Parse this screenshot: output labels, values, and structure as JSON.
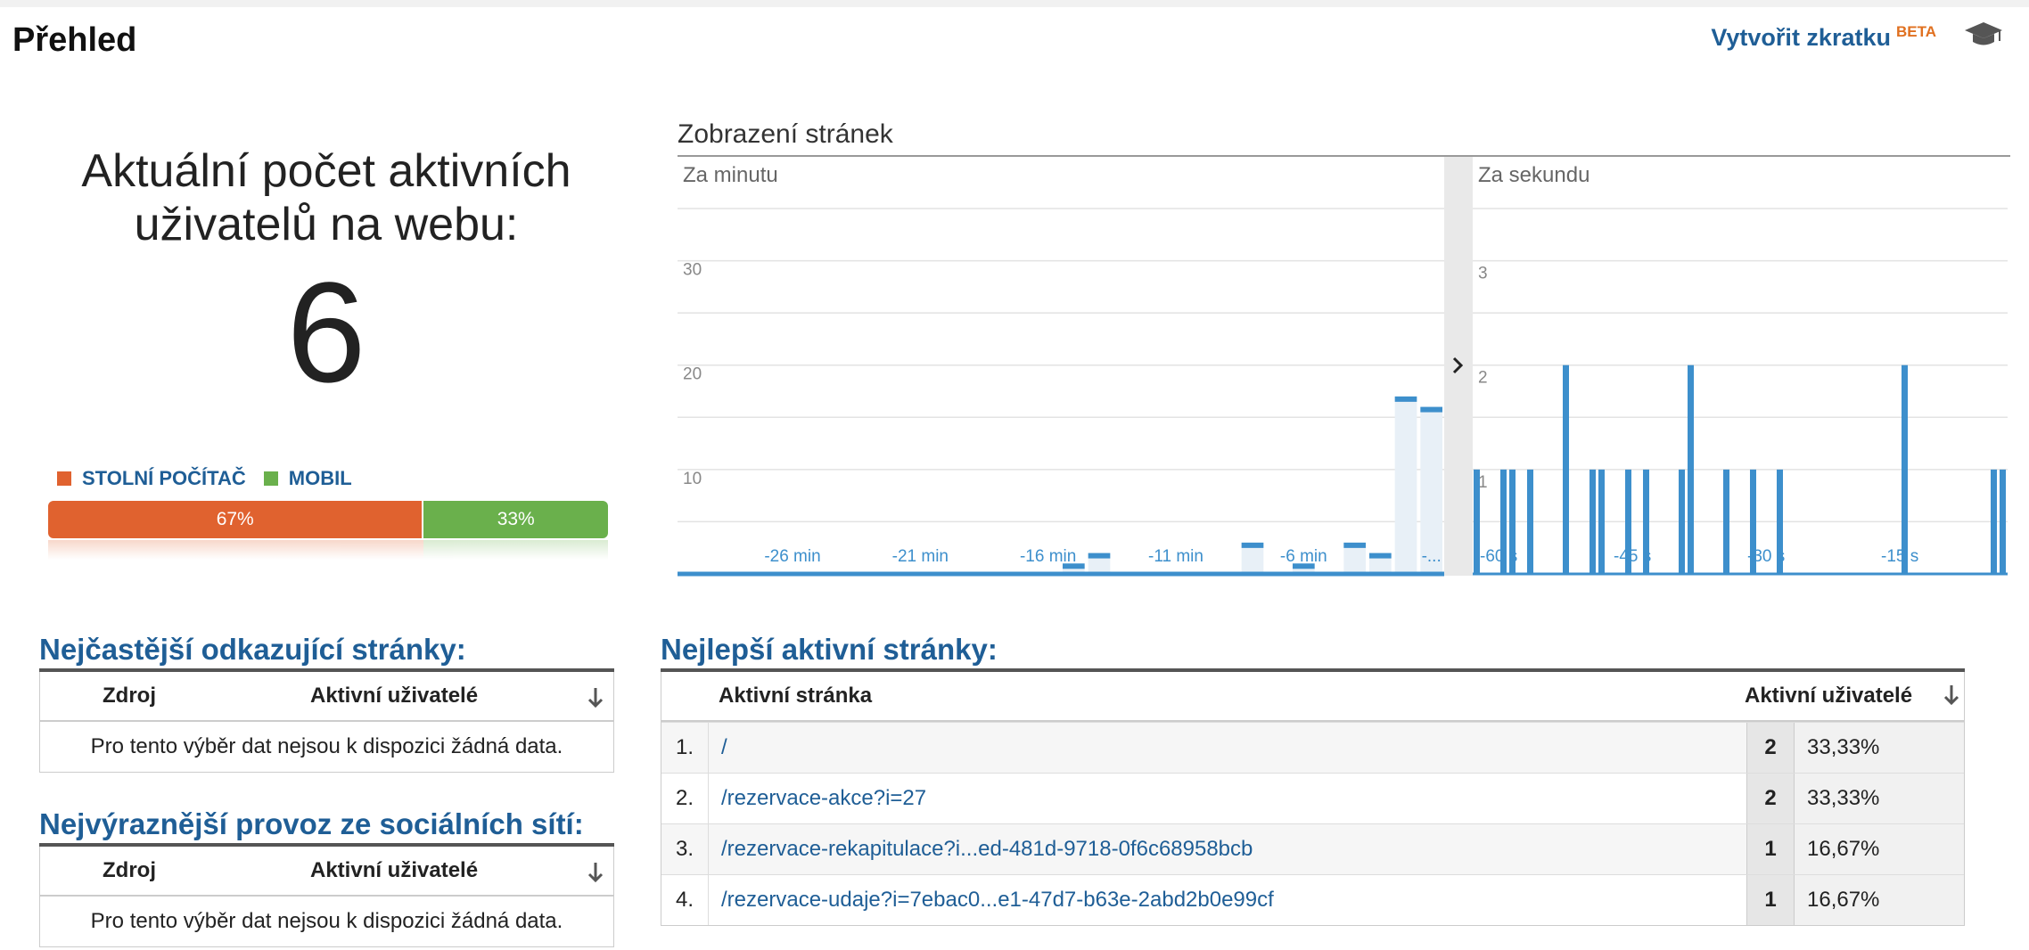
{
  "header": {
    "title": "Přehled",
    "shortcut_label": "Vytvořit zkratku",
    "shortcut_badge": "BETA",
    "cap_icon": "graduation-cap-icon"
  },
  "active_users": {
    "label": "Aktuální počet aktivních uživatelů na webu:",
    "count": "6",
    "legend": [
      {
        "label": "STOLNÍ POČÍTAČ",
        "color": "#e0622f"
      },
      {
        "label": "MOBIL",
        "color": "#6ab04c"
      }
    ],
    "split": [
      {
        "label": "67%",
        "fraction": 0.67,
        "color": "#e0622f"
      },
      {
        "label": "33%",
        "fraction": 0.33,
        "color": "#6ab04c"
      }
    ]
  },
  "pageviews": {
    "title": "Zobrazení stránek",
    "toggle_icon": "chevron-right-icon"
  },
  "chart_data": [
    {
      "type": "bar",
      "title": "Za minutu",
      "ylim": [
        0,
        35
      ],
      "yticks": [
        "10",
        "20",
        "30"
      ],
      "xtick_labels": [
        "-26 min",
        "-21 min",
        "-16 min",
        "-11 min",
        "-6 min",
        "-..."
      ],
      "x": [
        -30,
        -29,
        -28,
        -27,
        -26,
        -25,
        -24,
        -23,
        -22,
        -21,
        -20,
        -19,
        -18,
        -17,
        -16,
        -15,
        -14,
        -13,
        -12,
        -11,
        -10,
        -9,
        -8,
        -7,
        -6,
        -5,
        -4,
        -3,
        -2,
        -1
      ],
      "values": [
        0,
        0,
        0,
        0,
        0,
        0,
        0,
        0,
        0,
        0,
        0,
        0,
        0,
        0,
        0,
        1,
        2,
        0,
        0,
        0,
        0,
        0,
        3,
        0,
        1,
        0,
        3,
        2,
        17,
        16
      ],
      "grid": true
    },
    {
      "type": "bar",
      "title": "Za sekundu",
      "ylim": [
        0,
        3.5
      ],
      "yticks": [
        "1",
        "2",
        "3"
      ],
      "xtick_labels": [
        "-60 s",
        "-45 s",
        "-30 s",
        "-15 s"
      ],
      "x": [
        -60,
        -57,
        -56,
        -54,
        -50,
        -47,
        -46,
        -43,
        -41,
        -37,
        -36,
        -32,
        -29,
        -26,
        -12,
        -2,
        -1
      ],
      "values": [
        1,
        1,
        1,
        1,
        2,
        1,
        1,
        1,
        1,
        1,
        2,
        1,
        1,
        1,
        2,
        1,
        1
      ],
      "grid": true
    }
  ],
  "referrals": {
    "title": "Nejčastější odkazující stránky:",
    "col_source": "Zdroj",
    "col_users": "Aktivní uživatelé",
    "empty": "Pro tento výběr dat nejsou k dispozici žádná data."
  },
  "social": {
    "title": "Nejvýraznější provoz ze sociálních sítí:",
    "col_source": "Zdroj",
    "col_users": "Aktivní uživatelé",
    "empty": "Pro tento výběr dat nejsou k dispozici žádná data."
  },
  "top_pages": {
    "title": "Nejlepší aktivní stránky:",
    "col_page": "Aktivní stránka",
    "col_users": "Aktivní uživatelé",
    "rows": [
      {
        "n": "1.",
        "url": "/",
        "count": "2",
        "pct": "33,33%"
      },
      {
        "n": "2.",
        "url": "/rezervace-akce?i=27",
        "count": "2",
        "pct": "33,33%"
      },
      {
        "n": "3.",
        "url": "/rezervace-rekapitulace?i...ed-481d-9718-0f6c68958bcb",
        "count": "1",
        "pct": "16,67%"
      },
      {
        "n": "4.",
        "url": "/rezervace-udaje?i=7ebac0...e1-47d7-b63e-2abd2b0e99cf",
        "count": "1",
        "pct": "16,67%"
      }
    ]
  }
}
